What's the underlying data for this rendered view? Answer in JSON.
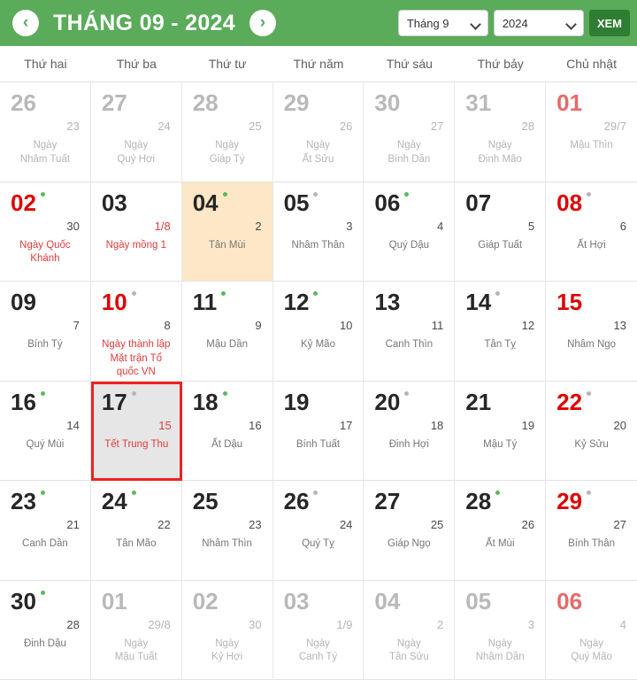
{
  "header": {
    "prev_icon": "chevron-left-icon",
    "next_icon": "chevron-right-icon",
    "prev_glyph": "‹",
    "next_glyph": "›",
    "title": "THÁNG 09 - 2024",
    "month_value": "Tháng 9",
    "year_value": "2024",
    "view_button": "XEM",
    "bg_color": "#5aab5a",
    "button_color": "#2e7d32"
  },
  "weekdays": [
    "Thứ hai",
    "Thứ ba",
    "Thứ tư",
    "Thứ năm",
    "Thứ sáu",
    "Thứ bảy",
    "Chủ nhật"
  ],
  "days": [
    {
      "solar": "26",
      "lunar": "23",
      "note": "Ngày\nNhâm Tuất",
      "state": "other",
      "dot": "none",
      "lunar_red": false,
      "note_red": false
    },
    {
      "solar": "27",
      "lunar": "24",
      "note": "Ngày\nQuý Hợi",
      "state": "other",
      "dot": "none",
      "lunar_red": false,
      "note_red": false
    },
    {
      "solar": "28",
      "lunar": "25",
      "note": "Ngày\nGiáp Tý",
      "state": "other",
      "dot": "none",
      "lunar_red": false,
      "note_red": false
    },
    {
      "solar": "29",
      "lunar": "26",
      "note": "Ngày\nẤt Sửu",
      "state": "other",
      "dot": "none",
      "lunar_red": false,
      "note_red": false
    },
    {
      "solar": "30",
      "lunar": "27",
      "note": "Ngày\nBính Dần",
      "state": "other",
      "dot": "none",
      "lunar_red": false,
      "note_red": false
    },
    {
      "solar": "31",
      "lunar": "28",
      "note": "Ngày\nĐinh Mão",
      "state": "other",
      "dot": "none",
      "lunar_red": false,
      "note_red": false
    },
    {
      "solar": "01",
      "lunar": "29/7",
      "note": "Mậu Thìn",
      "state": "other sun",
      "dot": "none",
      "lunar_red": false,
      "note_red": false
    },
    {
      "solar": "02",
      "lunar": "30",
      "note": "Ngày Quốc\nKhánh",
      "state": "holiday",
      "dot": "green",
      "lunar_red": false,
      "note_red": true
    },
    {
      "solar": "03",
      "lunar": "1/8",
      "note": "Ngày mồng 1",
      "state": "",
      "dot": "none",
      "lunar_red": true,
      "note_red": true
    },
    {
      "solar": "04",
      "lunar": "2",
      "note": "Tân Mùi",
      "state": "today",
      "dot": "green",
      "lunar_red": false,
      "note_red": false
    },
    {
      "solar": "05",
      "lunar": "3",
      "note": "Nhâm Thân",
      "state": "",
      "dot": "gray",
      "lunar_red": false,
      "note_red": false
    },
    {
      "solar": "06",
      "lunar": "4",
      "note": "Quý Dậu",
      "state": "",
      "dot": "green",
      "lunar_red": false,
      "note_red": false
    },
    {
      "solar": "07",
      "lunar": "5",
      "note": "Giáp Tuất",
      "state": "",
      "dot": "none",
      "lunar_red": false,
      "note_red": false
    },
    {
      "solar": "08",
      "lunar": "6",
      "note": "Ất Hợi",
      "state": "sun",
      "dot": "gray",
      "lunar_red": false,
      "note_red": false
    },
    {
      "solar": "09",
      "lunar": "7",
      "note": "Bính Tý",
      "state": "",
      "dot": "none",
      "lunar_red": false,
      "note_red": false
    },
    {
      "solar": "10",
      "lunar": "8",
      "note": "Ngày thành lập\nMặt trận Tổ\nquốc VN",
      "state": "holiday",
      "dot": "gray",
      "lunar_red": false,
      "note_red": true
    },
    {
      "solar": "11",
      "lunar": "9",
      "note": "Mậu Dần",
      "state": "",
      "dot": "green",
      "lunar_red": false,
      "note_red": false
    },
    {
      "solar": "12",
      "lunar": "10",
      "note": "Kỷ Mão",
      "state": "",
      "dot": "green",
      "lunar_red": false,
      "note_red": false
    },
    {
      "solar": "13",
      "lunar": "11",
      "note": "Canh Thìn",
      "state": "",
      "dot": "none",
      "lunar_red": false,
      "note_red": false
    },
    {
      "solar": "14",
      "lunar": "12",
      "note": "Tân Tỵ",
      "state": "",
      "dot": "gray",
      "lunar_red": false,
      "note_red": false
    },
    {
      "solar": "15",
      "lunar": "13",
      "note": "Nhâm Ngọ",
      "state": "sun",
      "dot": "none",
      "lunar_red": false,
      "note_red": false
    },
    {
      "solar": "16",
      "lunar": "14",
      "note": "Quý Mùi",
      "state": "",
      "dot": "green",
      "lunar_red": false,
      "note_red": false
    },
    {
      "solar": "17",
      "lunar": "15",
      "note": "Tết Trung Thu",
      "state": "selected",
      "dot": "gray",
      "lunar_red": true,
      "note_red": true
    },
    {
      "solar": "18",
      "lunar": "16",
      "note": "Ất Dậu",
      "state": "",
      "dot": "green",
      "lunar_red": false,
      "note_red": false
    },
    {
      "solar": "19",
      "lunar": "17",
      "note": "Bính Tuất",
      "state": "",
      "dot": "none",
      "lunar_red": false,
      "note_red": false
    },
    {
      "solar": "20",
      "lunar": "18",
      "note": "Đinh Hợi",
      "state": "",
      "dot": "gray",
      "lunar_red": false,
      "note_red": false
    },
    {
      "solar": "21",
      "lunar": "19",
      "note": "Mậu Tý",
      "state": "",
      "dot": "none",
      "lunar_red": false,
      "note_red": false
    },
    {
      "solar": "22",
      "lunar": "20",
      "note": "Kỷ Sửu",
      "state": "sun",
      "dot": "gray",
      "lunar_red": false,
      "note_red": false
    },
    {
      "solar": "23",
      "lunar": "21",
      "note": "Canh Dần",
      "state": "",
      "dot": "green",
      "lunar_red": false,
      "note_red": false
    },
    {
      "solar": "24",
      "lunar": "22",
      "note": "Tân Mão",
      "state": "",
      "dot": "green",
      "lunar_red": false,
      "note_red": false
    },
    {
      "solar": "25",
      "lunar": "23",
      "note": "Nhâm Thìn",
      "state": "",
      "dot": "none",
      "lunar_red": false,
      "note_red": false
    },
    {
      "solar": "26",
      "lunar": "24",
      "note": "Quý Tỵ",
      "state": "",
      "dot": "gray",
      "lunar_red": false,
      "note_red": false
    },
    {
      "solar": "27",
      "lunar": "25",
      "note": "Giáp Ngọ",
      "state": "",
      "dot": "none",
      "lunar_red": false,
      "note_red": false
    },
    {
      "solar": "28",
      "lunar": "26",
      "note": "Ất Mùi",
      "state": "",
      "dot": "green",
      "lunar_red": false,
      "note_red": false
    },
    {
      "solar": "29",
      "lunar": "27",
      "note": "Bính Thân",
      "state": "sun",
      "dot": "gray",
      "lunar_red": false,
      "note_red": false
    },
    {
      "solar": "30",
      "lunar": "28",
      "note": "Đinh Dậu",
      "state": "",
      "dot": "green",
      "lunar_red": false,
      "note_red": false
    },
    {
      "solar": "01",
      "lunar": "29/8",
      "note": "Ngày\nMậu Tuất",
      "state": "other",
      "dot": "none",
      "lunar_red": false,
      "note_red": false
    },
    {
      "solar": "02",
      "lunar": "30",
      "note": "Ngày\nKỷ Hợi",
      "state": "other",
      "dot": "none",
      "lunar_red": false,
      "note_red": false
    },
    {
      "solar": "03",
      "lunar": "1/9",
      "note": "Ngày\nCanh Tý",
      "state": "other",
      "dot": "none",
      "lunar_red": false,
      "note_red": false
    },
    {
      "solar": "04",
      "lunar": "2",
      "note": "Ngày\nTân Sửu",
      "state": "other",
      "dot": "none",
      "lunar_red": false,
      "note_red": false
    },
    {
      "solar": "05",
      "lunar": "3",
      "note": "Ngày\nNhâm Dần",
      "state": "other",
      "dot": "none",
      "lunar_red": false,
      "note_red": false
    },
    {
      "solar": "06",
      "lunar": "4",
      "note": "Ngày\nQuý Mão",
      "state": "other sun",
      "dot": "none",
      "lunar_red": false,
      "note_red": false
    }
  ]
}
